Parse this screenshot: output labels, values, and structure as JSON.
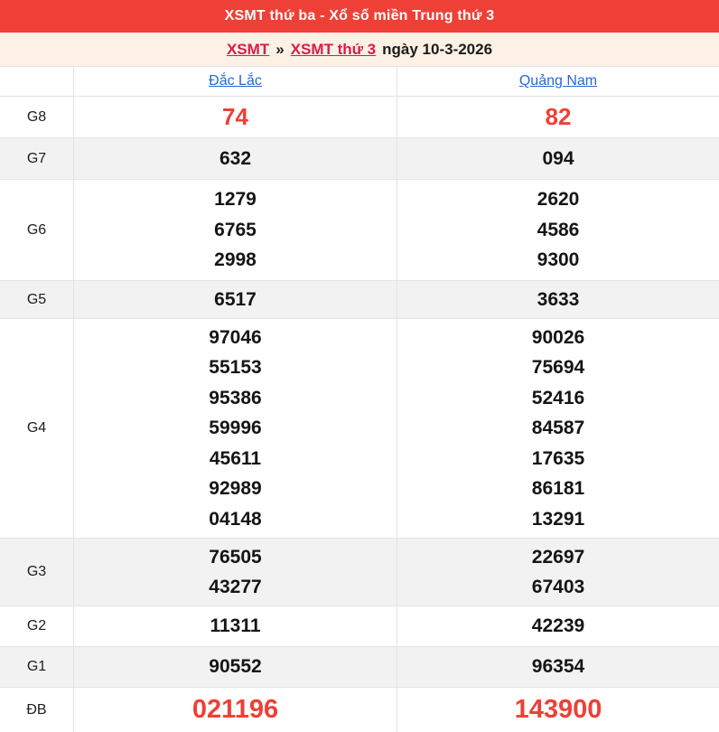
{
  "header": {
    "title": "XSMT thứ ba - Xổ số miền Trung thứ 3"
  },
  "breadcrumb": {
    "link_region": "XSMT",
    "separator": "»",
    "link_day": "XSMT thứ 3",
    "suffix": "ngày 10-3-2026"
  },
  "table": {
    "provinces": [
      "Đắc Lắc",
      "Quảng Nam"
    ],
    "rows": [
      {
        "label": "G8",
        "cols": [
          [
            "74"
          ],
          [
            "82"
          ]
        ]
      },
      {
        "label": "G7",
        "cols": [
          [
            "632"
          ],
          [
            "094"
          ]
        ]
      },
      {
        "label": "G6",
        "cols": [
          [
            "1279",
            "6765",
            "2998"
          ],
          [
            "2620",
            "4586",
            "9300"
          ]
        ]
      },
      {
        "label": "G5",
        "cols": [
          [
            "6517"
          ],
          [
            "3633"
          ]
        ]
      },
      {
        "label": "G4",
        "cols": [
          [
            "97046",
            "55153",
            "95386",
            "59996",
            "45611",
            "92989",
            "04148"
          ],
          [
            "90026",
            "75694",
            "52416",
            "84587",
            "17635",
            "86181",
            "13291"
          ]
        ]
      },
      {
        "label": "G3",
        "cols": [
          [
            "76505",
            "43277"
          ],
          [
            "22697",
            "67403"
          ]
        ]
      },
      {
        "label": "G2",
        "cols": [
          [
            "11311"
          ],
          [
            "42239"
          ]
        ]
      },
      {
        "label": "G1",
        "cols": [
          [
            "90552"
          ],
          [
            "96354"
          ]
        ]
      },
      {
        "label": "ĐB",
        "cols": [
          [
            "021196"
          ],
          [
            "143900"
          ]
        ]
      }
    ]
  },
  "colors": {
    "header_bg": "#ee4036",
    "highlight_number": "#ee4036",
    "breadcrumb_bg": "#fdf1e6",
    "breadcrumb_link": "#e0184c",
    "province_link": "#2a66d9",
    "stripe_row": "#f2f2f2",
    "border": "#e3e3e3"
  }
}
